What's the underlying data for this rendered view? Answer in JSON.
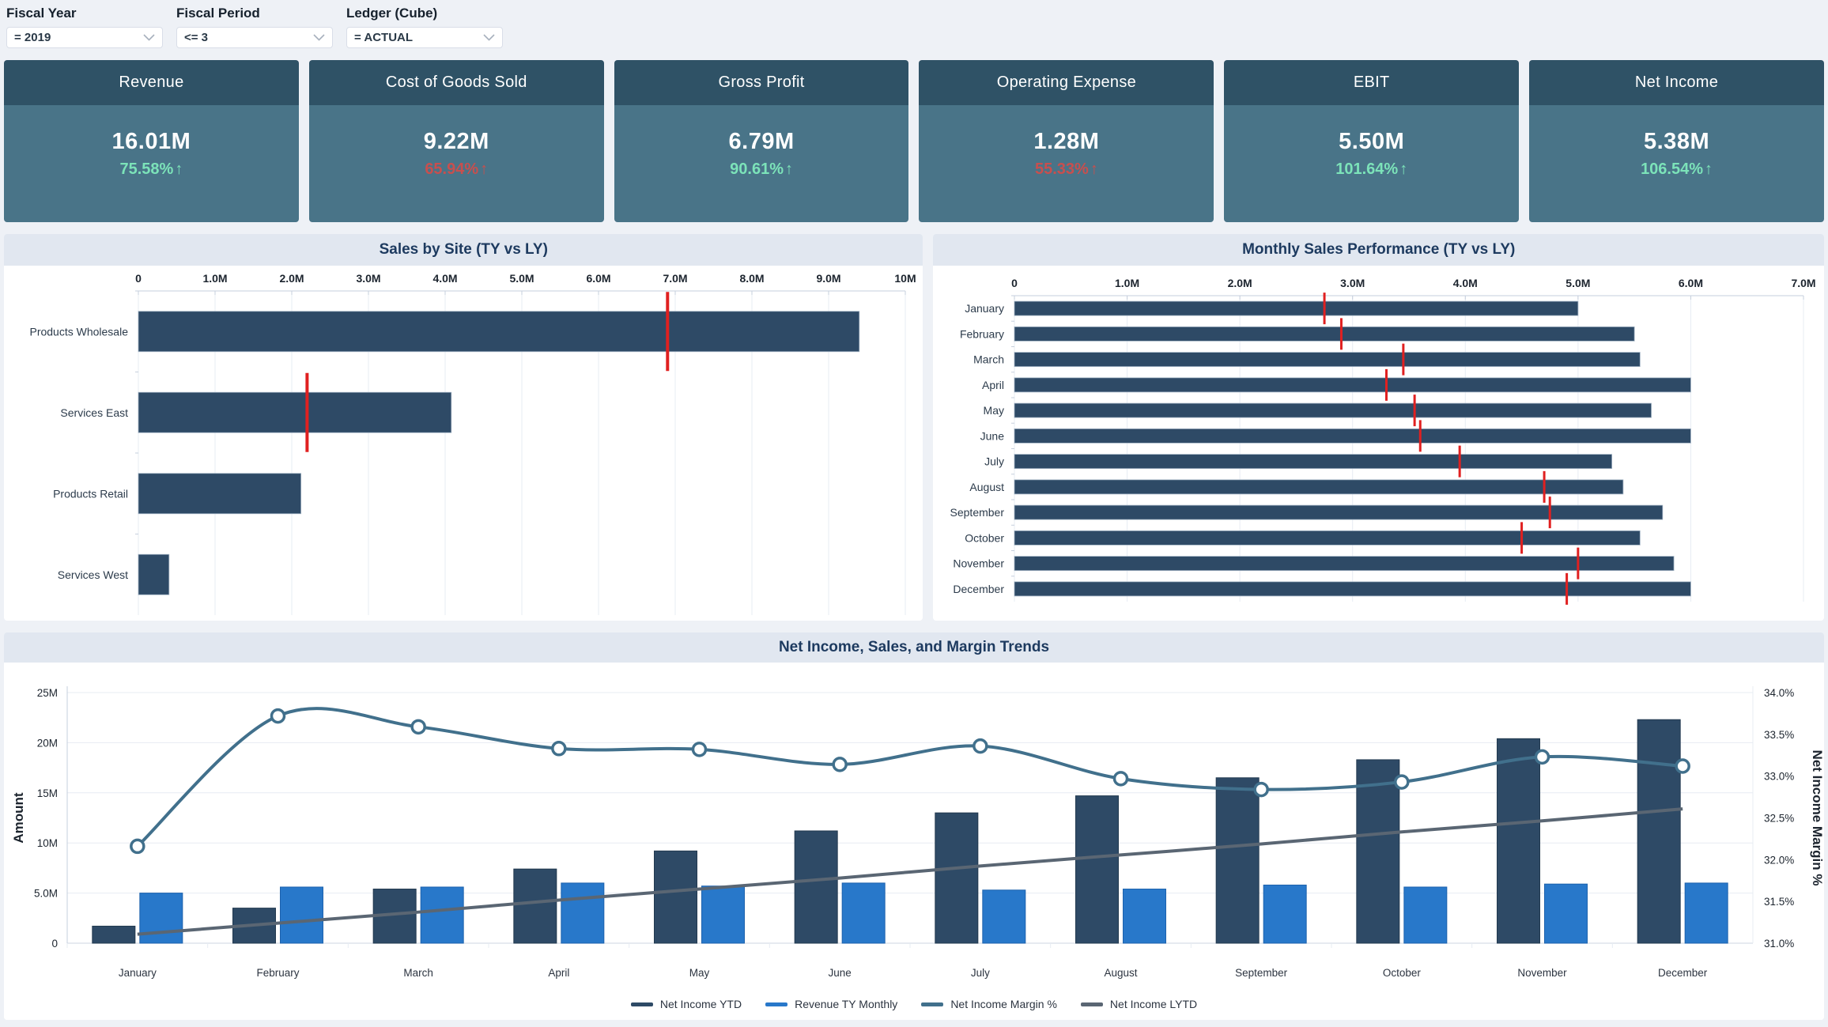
{
  "filters": [
    {
      "label": "Fiscal Year",
      "value": "= 2019"
    },
    {
      "label": "Fiscal Period",
      "value": "<= 3"
    },
    {
      "label": "Ledger (Cube)",
      "value": "= ACTUAL"
    }
  ],
  "kpis": [
    {
      "title": "Revenue",
      "value": "16.01M",
      "delta": "75.58%",
      "arrow": "↑",
      "trend": "good"
    },
    {
      "title": "Cost of Goods Sold",
      "value": "9.22M",
      "delta": "65.94%",
      "arrow": "↑",
      "trend": "bad"
    },
    {
      "title": "Gross Profit",
      "value": "6.79M",
      "delta": "90.61%",
      "arrow": "↑",
      "trend": "good"
    },
    {
      "title": "Operating Expense",
      "value": "1.28M",
      "delta": "55.33%",
      "arrow": "↑",
      "trend": "bad"
    },
    {
      "title": "EBIT",
      "value": "5.50M",
      "delta": "101.64%",
      "arrow": "↑",
      "trend": "good"
    },
    {
      "title": "Net Income",
      "value": "5.38M",
      "delta": "106.54%",
      "arrow": "↑",
      "trend": "good"
    }
  ],
  "colors": {
    "page_bg": "#eef1f6",
    "panel_header": "#e1e7f0",
    "kpi_header": "#2f5266",
    "kpi_body": "#497488",
    "positive": "#7ce3b9",
    "negative": "#c84f4e",
    "bar_navy": "#2e4a66",
    "bar_blue": "#2878ca",
    "line_teal": "#41708c",
    "line_gray": "#5a6673",
    "target_red": "#e02020",
    "grid": "#e7ecf3",
    "axis": "#c6cfdc"
  },
  "chart_data": [
    {
      "id": "sales_by_site",
      "type": "bar",
      "orientation": "horizontal",
      "title": "Sales by Site (TY vs LY)",
      "categories": [
        "Products Wholesale",
        "Services East",
        "Products Retail",
        "Services West"
      ],
      "series": [
        {
          "name": "TY",
          "color": "#2e4a66",
          "values": [
            9.4,
            4.08,
            2.12,
            0.4
          ]
        },
        {
          "name": "LY",
          "color": "#e02020",
          "values": [
            6.9,
            2.2,
            null,
            null
          ]
        }
      ],
      "xlim": [
        0,
        10
      ],
      "x_ticks": [
        "0",
        "1.0M",
        "2.0M",
        "3.0M",
        "4.0M",
        "5.0M",
        "6.0M",
        "7.0M",
        "8.0M",
        "9.0M",
        "10M"
      ],
      "x_tick_values": [
        0,
        1,
        2,
        3,
        4,
        5,
        6,
        7,
        8,
        9,
        10
      ]
    },
    {
      "id": "monthly_sales_performance",
      "type": "bar",
      "orientation": "horizontal",
      "title": "Monthly Sales Performance (TY vs LY)",
      "categories": [
        "January",
        "February",
        "March",
        "April",
        "May",
        "June",
        "July",
        "August",
        "September",
        "October",
        "November",
        "December"
      ],
      "series": [
        {
          "name": "TY",
          "color": "#2e4a66",
          "values": [
            5.0,
            5.5,
            5.55,
            6.0,
            5.65,
            6.0,
            5.3,
            5.4,
            5.75,
            5.55,
            5.85,
            6.0
          ]
        },
        {
          "name": "LY",
          "color": "#e02020",
          "values": [
            2.75,
            2.9,
            3.45,
            3.3,
            3.55,
            3.6,
            3.95,
            4.7,
            4.75,
            4.5,
            5.0,
            4.9
          ]
        }
      ],
      "xlim": [
        0,
        7
      ],
      "x_ticks": [
        "0",
        "1.0M",
        "2.0M",
        "3.0M",
        "4.0M",
        "5.0M",
        "6.0M",
        "7.0M"
      ],
      "x_tick_values": [
        0,
        1,
        2,
        3,
        4,
        5,
        6,
        7
      ]
    },
    {
      "id": "trends",
      "type": "combo",
      "title": "Net Income, Sales, and Margin Trends",
      "categories": [
        "January",
        "February",
        "March",
        "April",
        "May",
        "June",
        "July",
        "August",
        "September",
        "October",
        "November",
        "December"
      ],
      "ylabel": "Amount",
      "y2label": "Net Income Margin %",
      "ylim": [
        0,
        25
      ],
      "y_ticks": [
        "0",
        "5.0M",
        "10M",
        "15M",
        "20M",
        "25M"
      ],
      "y_tick_values": [
        0,
        5,
        10,
        15,
        20,
        25
      ],
      "y2lim": [
        31,
        34
      ],
      "y2_ticks": [
        "31.0%",
        "31.5%",
        "32.0%",
        "32.5%",
        "33.0%",
        "33.5%",
        "34.0%"
      ],
      "y2_tick_values": [
        31,
        31.5,
        32,
        32.5,
        33,
        33.5,
        34
      ],
      "series": [
        {
          "name": "Net Income YTD",
          "type": "bar",
          "axis": "left",
          "color": "#2e4a66",
          "values": [
            1.7,
            3.5,
            5.4,
            7.4,
            9.2,
            11.2,
            13.0,
            14.7,
            16.5,
            18.3,
            20.4,
            22.3
          ]
        },
        {
          "name": "Revenue TY Monthly",
          "type": "bar",
          "axis": "left",
          "color": "#2878ca",
          "values": [
            5.0,
            5.6,
            5.6,
            6.0,
            5.7,
            6.0,
            5.3,
            5.4,
            5.8,
            5.6,
            5.9,
            6.0
          ]
        },
        {
          "name": "Net Income Margin %",
          "type": "line",
          "axis": "right",
          "marker": true,
          "color": "#41708c",
          "values": [
            32.16,
            33.72,
            33.59,
            33.33,
            33.32,
            33.14,
            33.36,
            32.97,
            32.84,
            32.93,
            33.23,
            33.12
          ]
        },
        {
          "name": "Net Income LYTD",
          "type": "line",
          "axis": "left",
          "marker": false,
          "color": "#5a6673",
          "values": [
            0.9,
            2.0,
            3.1,
            4.3,
            5.4,
            6.5,
            7.7,
            8.8,
            9.9,
            11.1,
            12.2,
            13.4
          ]
        }
      ]
    }
  ]
}
